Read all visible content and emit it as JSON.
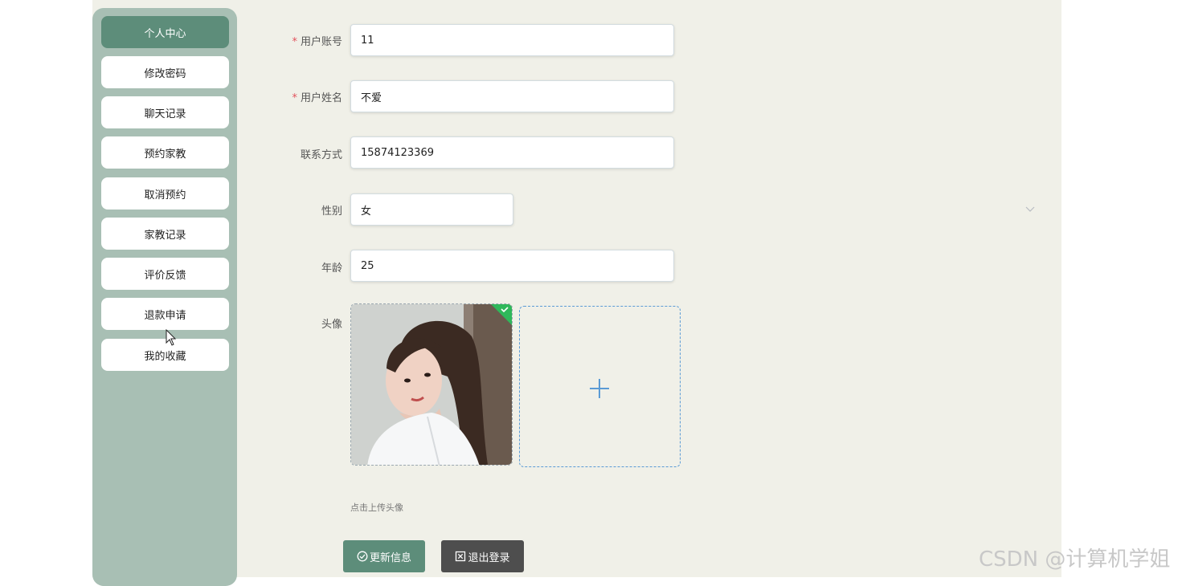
{
  "sidebar": {
    "items": [
      {
        "label": "个人中心",
        "active": true
      },
      {
        "label": "修改密码"
      },
      {
        "label": "聊天记录"
      },
      {
        "label": "预约家教"
      },
      {
        "label": "取消预约"
      },
      {
        "label": "家教记录"
      },
      {
        "label": "评价反馈"
      },
      {
        "label": "退款申请"
      },
      {
        "label": "我的收藏"
      }
    ]
  },
  "form": {
    "account": {
      "label": "用户账号",
      "required_mark": "*",
      "value": "11"
    },
    "name": {
      "label": "用户姓名",
      "required_mark": "*",
      "value": "不爱"
    },
    "phone": {
      "label": "联系方式",
      "value": "15874123369"
    },
    "gender": {
      "label": "性别",
      "value": "女"
    },
    "age": {
      "label": "年龄",
      "value": "25"
    },
    "avatar": {
      "label": "头像",
      "hint": "点击上传头像"
    }
  },
  "buttons": {
    "update": "更新信息",
    "logout": "退出登录"
  },
  "watermark": "CSDN @计算机学姐",
  "colors": {
    "page_bg": "#f0f0e8",
    "sidebar_bg": "#a8bfb4",
    "accent": "#5d8d7a",
    "logout": "#4e4e4e",
    "required": "#e2525c",
    "upload_border": "#5b9bd5",
    "success_badge": "#2fb85b"
  }
}
